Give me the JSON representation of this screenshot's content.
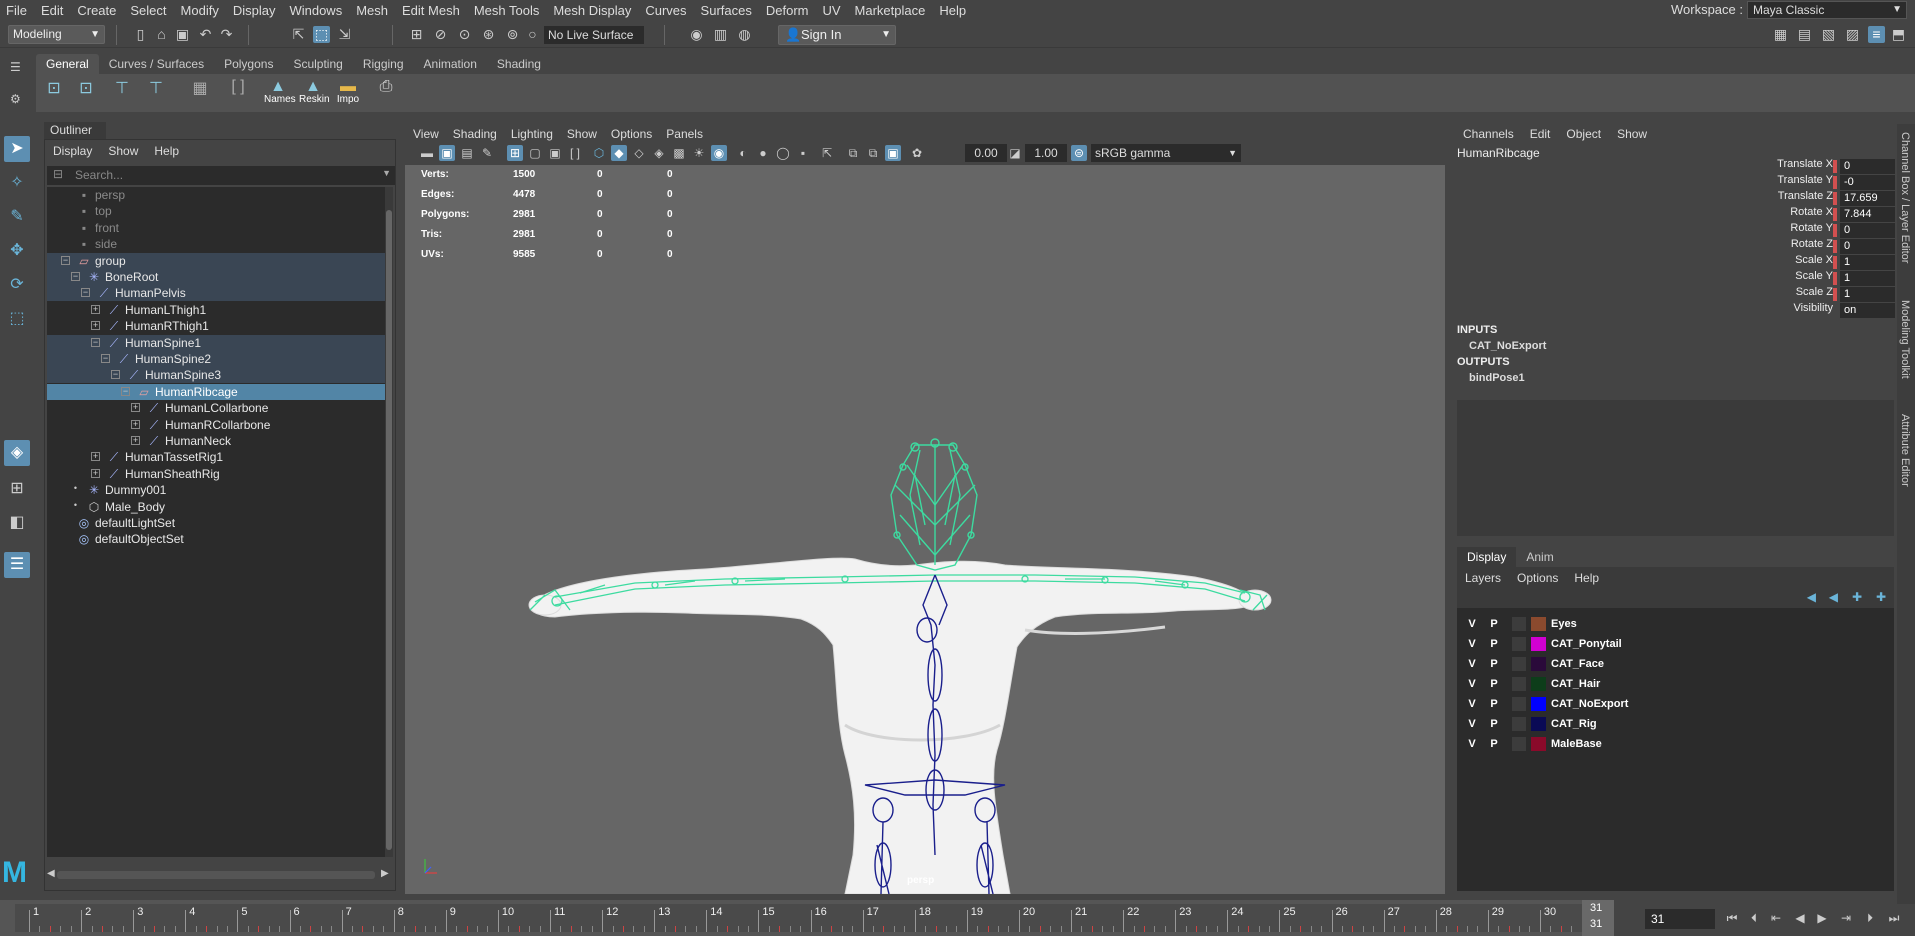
{
  "menu": [
    "File",
    "Edit",
    "Create",
    "Select",
    "Modify",
    "Display",
    "Windows",
    "Mesh",
    "Edit Mesh",
    "Mesh Tools",
    "Mesh Display",
    "Curves",
    "Surfaces",
    "Deform",
    "UV",
    "Marketplace",
    "Help"
  ],
  "workspace": {
    "label": "Workspace :",
    "value": "Maya Classic"
  },
  "status": {
    "mode": "Modeling",
    "live_surface": "No Live Surface",
    "sign_in": "Sign In"
  },
  "shelf": {
    "tabs": [
      "General",
      "Curves / Surfaces",
      "Polygons",
      "Sculpting",
      "Rigging",
      "Animation",
      "Shading"
    ],
    "active_tab": "General",
    "labeled_buttons": [
      "Names",
      "Reskin",
      "Impo"
    ]
  },
  "outliner": {
    "title": "Outliner",
    "menu": [
      "Display",
      "Show",
      "Help"
    ],
    "search_placeholder": "Search...",
    "items": [
      {
        "name": "persp",
        "depth": 0,
        "icon": "camera-icon",
        "dim": true
      },
      {
        "name": "top",
        "depth": 0,
        "icon": "camera-icon",
        "dim": true
      },
      {
        "name": "front",
        "depth": 0,
        "icon": "camera-icon",
        "dim": true
      },
      {
        "name": "side",
        "depth": 0,
        "icon": "camera-icon",
        "dim": true
      },
      {
        "name": "group",
        "depth": 0,
        "icon": "group-icon",
        "state": "group"
      },
      {
        "name": "BoneRoot",
        "depth": 1,
        "icon": "dummy-icon",
        "state": "group"
      },
      {
        "name": "HumanPelvis",
        "depth": 2,
        "icon": "joint-icon",
        "state": "group"
      },
      {
        "name": "HumanLThigh1",
        "depth": 3,
        "icon": "joint-icon"
      },
      {
        "name": "HumanRThigh1",
        "depth": 3,
        "icon": "joint-icon"
      },
      {
        "name": "HumanSpine1",
        "depth": 3,
        "icon": "joint-icon",
        "state": "group"
      },
      {
        "name": "HumanSpine2",
        "depth": 4,
        "icon": "joint-icon",
        "state": "group"
      },
      {
        "name": "HumanSpine3",
        "depth": 5,
        "icon": "joint-icon",
        "state": "group"
      },
      {
        "name": "HumanRibcage",
        "depth": 6,
        "icon": "group-icon",
        "state": "selected"
      },
      {
        "name": "HumanLCollarbone",
        "depth": 7,
        "icon": "joint-icon"
      },
      {
        "name": "HumanRCollarbone",
        "depth": 7,
        "icon": "joint-icon"
      },
      {
        "name": "HumanNeck",
        "depth": 7,
        "icon": "joint-icon"
      },
      {
        "name": "HumanTassetRig1",
        "depth": 3,
        "icon": "joint-icon"
      },
      {
        "name": "HumanSheathRig",
        "depth": 3,
        "icon": "joint-icon"
      },
      {
        "name": "Dummy001",
        "depth": 1,
        "icon": "dummy-icon"
      },
      {
        "name": "Male_Body",
        "depth": 1,
        "icon": "mesh-icon"
      },
      {
        "name": "defaultLightSet",
        "depth": 0,
        "icon": "set-icon"
      },
      {
        "name": "defaultObjectSet",
        "depth": 0,
        "icon": "set-icon"
      }
    ]
  },
  "viewport": {
    "menu": [
      "View",
      "Shading",
      "Lighting",
      "Show",
      "Options",
      "Panels"
    ],
    "exposure": "0.00",
    "gamma": "1.00",
    "color_space": "sRGB gamma",
    "camera": "persp",
    "hud": [
      {
        "label": "Verts:",
        "a": "1500",
        "b": "0",
        "c": "0"
      },
      {
        "label": "Edges:",
        "a": "4478",
        "b": "0",
        "c": "0"
      },
      {
        "label": "Polygons:",
        "a": "2981",
        "b": "0",
        "c": "0"
      },
      {
        "label": "Tris:",
        "a": "2981",
        "b": "0",
        "c": "0"
      },
      {
        "label": "UVs:",
        "a": "9585",
        "b": "0",
        "c": "0"
      }
    ],
    "colors": {
      "background": "#666666",
      "skeleton_selected": "#3ddba0",
      "skeleton": "#1a1f8c",
      "mesh": "#f2f2f2"
    }
  },
  "channel_box": {
    "menu": [
      "Channels",
      "Edit",
      "Object",
      "Show"
    ],
    "object": "HumanRibcage",
    "attributes": [
      {
        "name": "Translate X",
        "value": "0"
      },
      {
        "name": "Translate Y",
        "value": "-0"
      },
      {
        "name": "Translate Z",
        "value": "17.659"
      },
      {
        "name": "Rotate X",
        "value": "7.844"
      },
      {
        "name": "Rotate Y",
        "value": "0"
      },
      {
        "name": "Rotate Z",
        "value": "0"
      },
      {
        "name": "Scale X",
        "value": "1"
      },
      {
        "name": "Scale Y",
        "value": "1"
      },
      {
        "name": "Scale Z",
        "value": "1"
      },
      {
        "name": "Visibility",
        "value": "on"
      }
    ],
    "inputs_label": "INPUTS",
    "inputs": [
      "CAT_NoExport"
    ],
    "outputs_label": "OUTPUTS",
    "outputs": [
      "bindPose1"
    ]
  },
  "side_tabs": [
    "Channel Box / Layer Editor",
    "Modeling Toolkit",
    "Attribute Editor"
  ],
  "layers": {
    "tabs": [
      "Display",
      "Anim"
    ],
    "active_tab": "Display",
    "menu": [
      "Layers",
      "Options",
      "Help"
    ],
    "items": [
      {
        "name": "Eyes",
        "v": "V",
        "p": "P",
        "color": "#8b4a2e"
      },
      {
        "name": "CAT_Ponytail",
        "v": "V",
        "p": "P",
        "color": "#d100d1"
      },
      {
        "name": "CAT_Face",
        "v": "V",
        "p": "P",
        "color": "#2a0a3a"
      },
      {
        "name": "CAT_Hair",
        "v": "V",
        "p": "P",
        "color": "#0d3d1a"
      },
      {
        "name": "CAT_NoExport",
        "v": "V",
        "p": "P",
        "color": "#0000ff"
      },
      {
        "name": "CAT_Rig",
        "v": "V",
        "p": "P",
        "color": "#0a0a55"
      },
      {
        "name": "MaleBase",
        "v": "V",
        "p": "P",
        "color": "#8a0a2a"
      }
    ]
  },
  "timeline": {
    "ticks": [
      "1",
      "2",
      "3",
      "4",
      "5",
      "6",
      "7",
      "8",
      "9",
      "10",
      "11",
      "12",
      "13",
      "14",
      "15",
      "16",
      "17",
      "18",
      "19",
      "20",
      "21",
      "22",
      "23",
      "24",
      "25",
      "26",
      "27",
      "28",
      "29",
      "30"
    ],
    "current_frame": "31",
    "current_frame_field": "31"
  }
}
